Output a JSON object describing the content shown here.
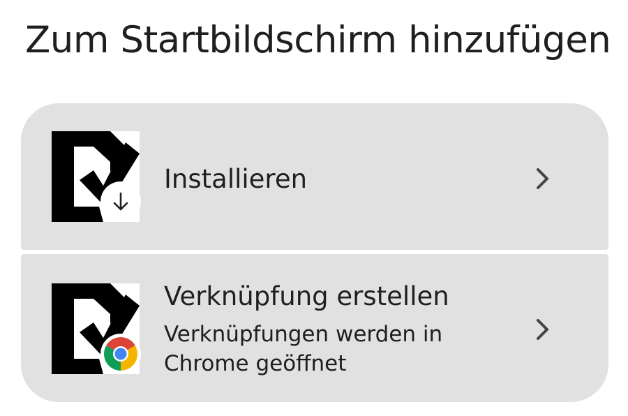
{
  "dialog": {
    "title": "Zum Startbildschirm hinzufügen"
  },
  "options": [
    {
      "label": "Installieren",
      "icon": "app-logo-checkmark-icon",
      "badge_icon": "download-arrow-icon",
      "chevron_icon": "chevron-right-icon"
    },
    {
      "label": "Verknüpfung erstellen",
      "description": "Verknüpfungen werden in Chrome geöffnet",
      "icon": "app-logo-checkmark-icon",
      "badge_icon": "chrome-icon",
      "chevron_icon": "chevron-right-icon"
    }
  ],
  "colors": {
    "card_background": "#e1e1e1",
    "page_background": "#ffffff",
    "text": "#1f1f1f",
    "chrome_red": "#db4437",
    "chrome_yellow": "#f4b400",
    "chrome_green": "#0f9d58",
    "chrome_blue": "#4285f4"
  }
}
